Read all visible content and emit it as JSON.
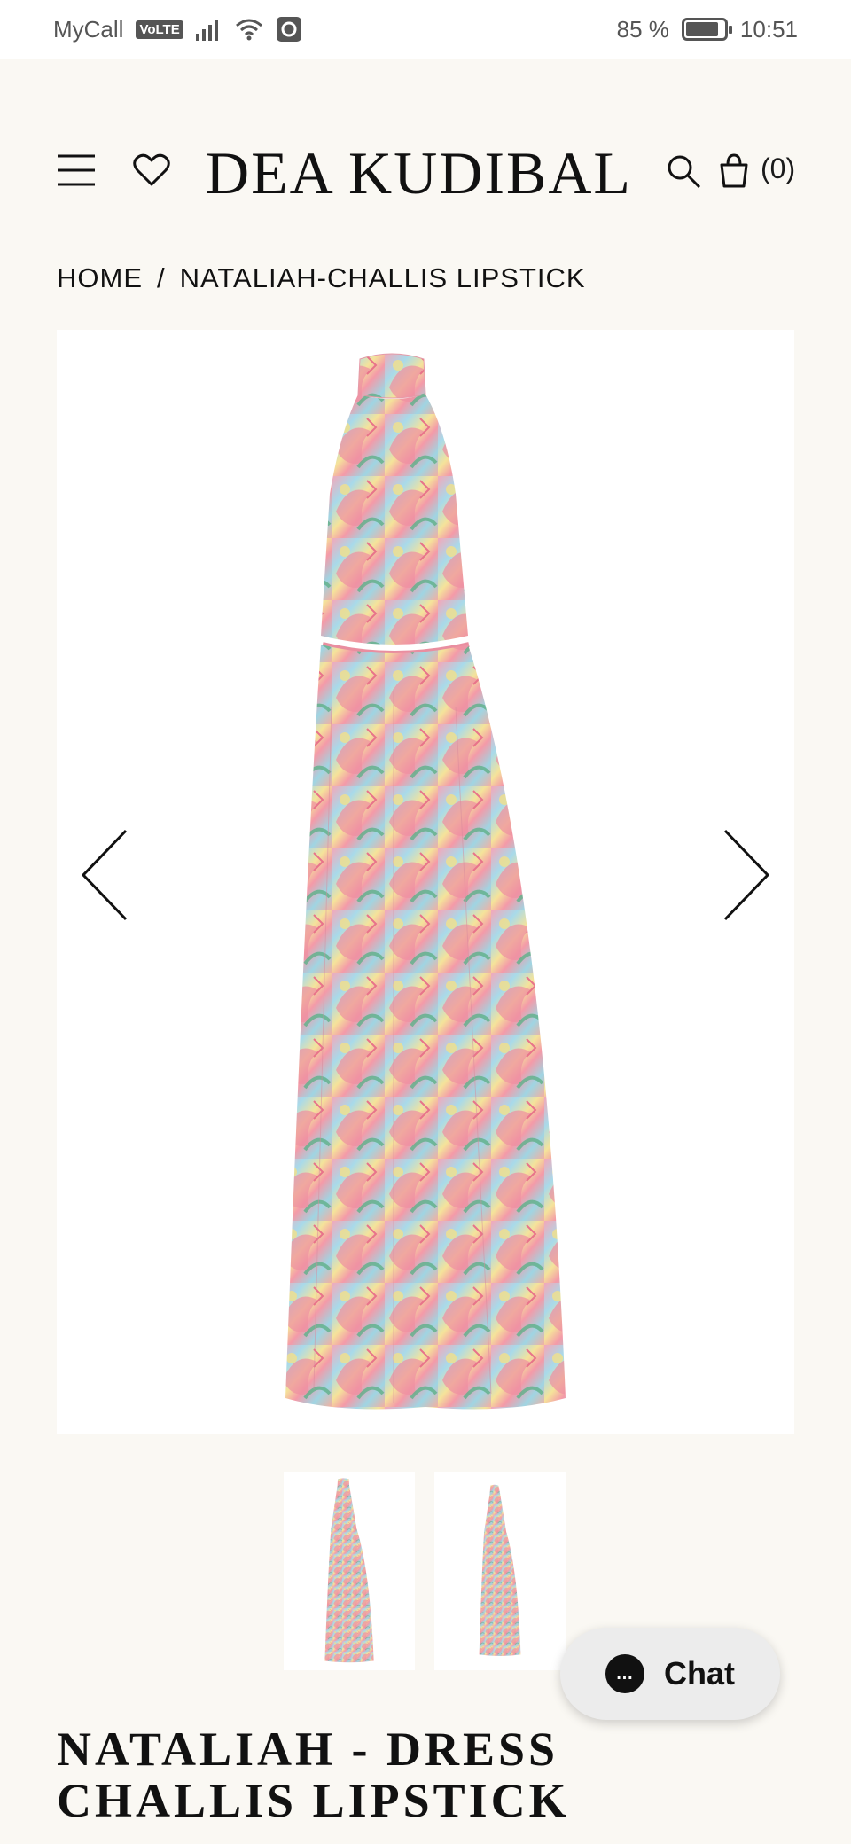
{
  "status_bar": {
    "carrier": "MyCall",
    "volte": "VoLTE",
    "battery_text": "85 %",
    "battery_level": 0.85,
    "time": "10:51"
  },
  "header": {
    "brand": "DEA KUDIBAL",
    "cart_count": "(0)",
    "icons": [
      "menu-icon",
      "heart-icon",
      "search-icon",
      "bag-icon"
    ]
  },
  "breadcrumb": {
    "home": "HOME",
    "separator": "/",
    "current": "NATALIAH-CHALLIS LIPSTICK"
  },
  "gallery": {
    "image_count": 2,
    "current_index": 1
  },
  "chat": {
    "label": "Chat",
    "bubble_dots": "…"
  },
  "product": {
    "title_line1": "NATALIAH - DRESS",
    "title_line2": "CHALLIS LIPSTICK"
  },
  "colors": {
    "background": "#faf8f3",
    "text": "#111111",
    "dress_pink": "#f0a0b4",
    "dress_blue": "#9ed6e6",
    "dress_yellow": "#f2e08a",
    "dress_green": "#5fb08a"
  }
}
